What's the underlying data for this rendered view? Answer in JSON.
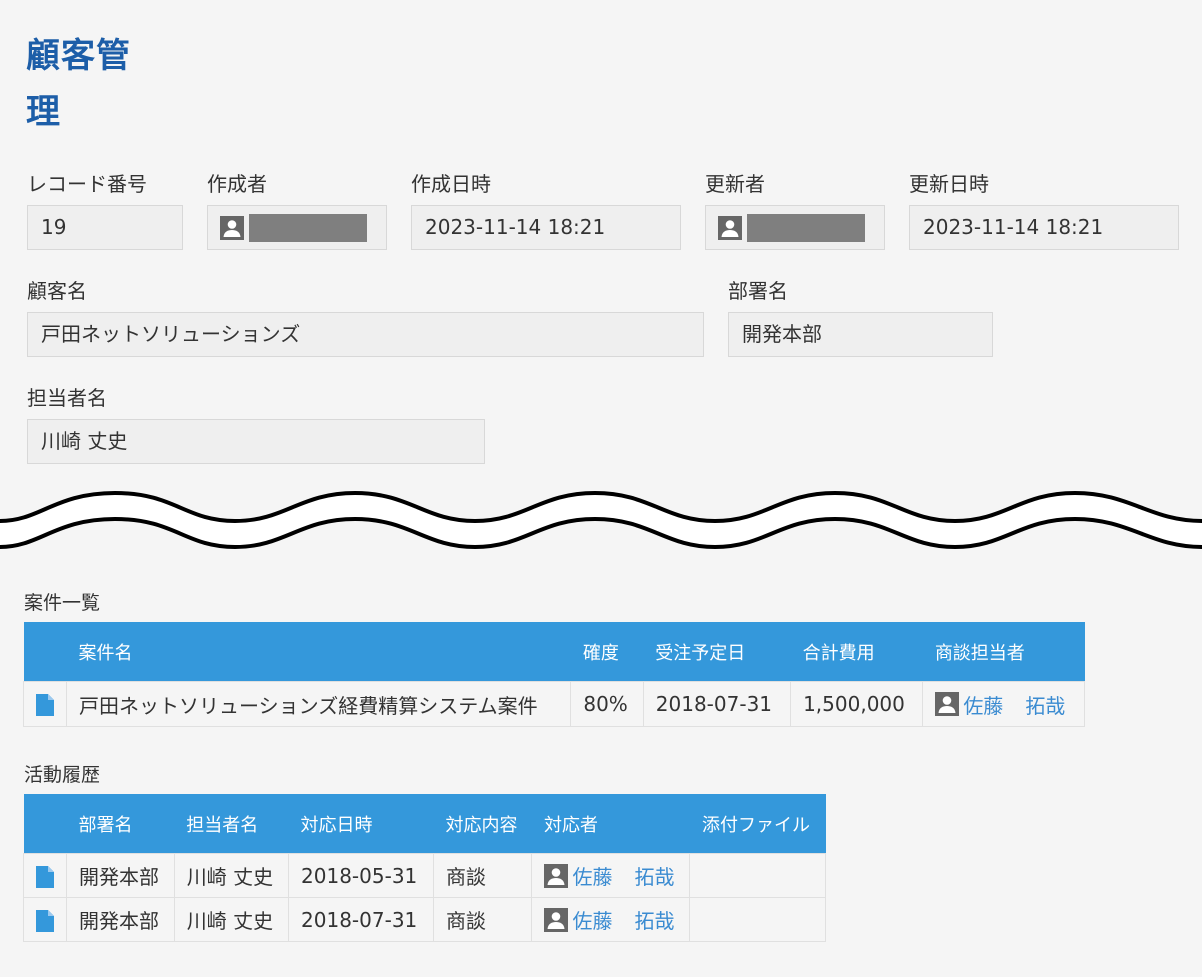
{
  "app": {
    "title": "顧客管理"
  },
  "record": {
    "fields": {
      "record_number": {
        "label": "レコード番号",
        "value": "19"
      },
      "creator": {
        "label": "作成者"
      },
      "created_at": {
        "label": "作成日時",
        "value": "2023-11-14 18:21"
      },
      "updater": {
        "label": "更新者"
      },
      "updated_at": {
        "label": "更新日時",
        "value": "2023-11-14 18:21"
      },
      "customer_name": {
        "label": "顧客名",
        "value": "戸田ネットソリューションズ"
      },
      "department": {
        "label": "部署名",
        "value": "開発本部"
      },
      "contact_person": {
        "label": "担当者名",
        "value": "川崎 丈史"
      }
    }
  },
  "deals": {
    "section_label": "案件一覧",
    "headers": [
      "案件名",
      "確度",
      "受注予定日",
      "合計費用",
      "商談担当者"
    ],
    "rows": [
      {
        "name": "戸田ネットソリューションズ経費精算システム案件",
        "probability": "80%",
        "date": "2018-07-31",
        "total": "1,500,000",
        "owner_last": "佐藤",
        "owner_first": "拓哉"
      }
    ]
  },
  "activities": {
    "section_label": "活動履歴",
    "headers": [
      "部署名",
      "担当者名",
      "対応日時",
      "対応内容",
      "対応者",
      "添付ファイル"
    ],
    "rows": [
      {
        "department": "開発本部",
        "person": "川崎 丈史",
        "date": "2018-05-31",
        "content": "商談",
        "handler_last": "佐藤",
        "handler_first": "拓哉",
        "attachment": ""
      },
      {
        "department": "開発本部",
        "person": "川崎 丈史",
        "date": "2018-07-31",
        "content": "商談",
        "handler_last": "佐藤",
        "handler_first": "拓哉",
        "attachment": ""
      }
    ]
  },
  "colors": {
    "accent": "#3498db",
    "title": "#1d5ea8",
    "link": "#3a8bd1"
  },
  "icons": {
    "user": "user-icon",
    "document": "document-icon"
  }
}
